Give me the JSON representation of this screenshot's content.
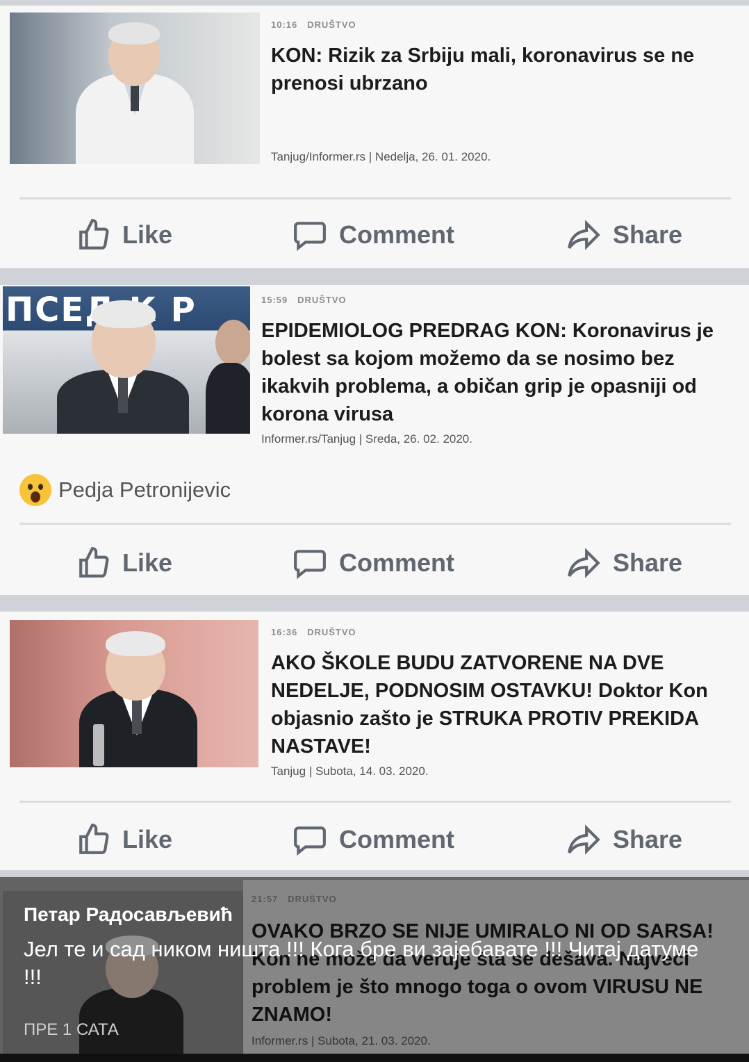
{
  "posts": [
    {
      "time": "10:16",
      "category": "DRUŠTVO",
      "headline": "KON: Rizik za Srbiju mali, koronavirus se ne prenosi ubrzano",
      "source": "Tanjug/Informer.rs | Nedelja, 26. 01. 2020."
    },
    {
      "time": "15:59",
      "category": "DRUŠTVO",
      "headline": "EPIDEMIOLOG PREDRAG KON: Koronavirus je bolest sa kojom možemo da se nosimo bez ikakvih problema, a običan grip je opasniji od korona virusa",
      "source": "Informer.rs/Tanjug | Sreda, 26. 02. 2020.",
      "banner_text": "ПСЕД  К Р",
      "reactor": "Pedja Petronijevic"
    },
    {
      "time": "16:36",
      "category": "DRUŠTVO",
      "headline": "AKO ŠKOLE BUDU ZATVORENE NA DVE NEDELJE, PODNOSIM OSTAVKU! Doktor Kon objasnio zašto je STRUKA PROTIV PREKIDA NASTAVE!",
      "source": "Tanjug | Subota, 14. 03. 2020."
    },
    {
      "time": "21:57",
      "category": "DRUŠTVO",
      "headline": "OVAKO BRZO SE NIJE UMIRALO NI OD SARSA! Kon ne može da veruje šta se dešava. Najveći problem je što mnogo toga o ovom VIRUSU NE ZNAMO!",
      "source": "Informer.rs | Subota, 21. 03. 2020."
    }
  ],
  "actions": {
    "like": "Like",
    "comment": "Comment",
    "share": "Share"
  },
  "story": {
    "user": "Петар Радосављевић",
    "text": "Јел те и сад ником ништа !!! Кога бре ви зајебавате !!! Читај датуме !!!",
    "time": "ПРЕ 1 САТА"
  },
  "colors": {
    "background": "#cfd3d8",
    "card": "#f7f7f8",
    "action_text": "#616770",
    "headline": "#1c1c1c"
  }
}
